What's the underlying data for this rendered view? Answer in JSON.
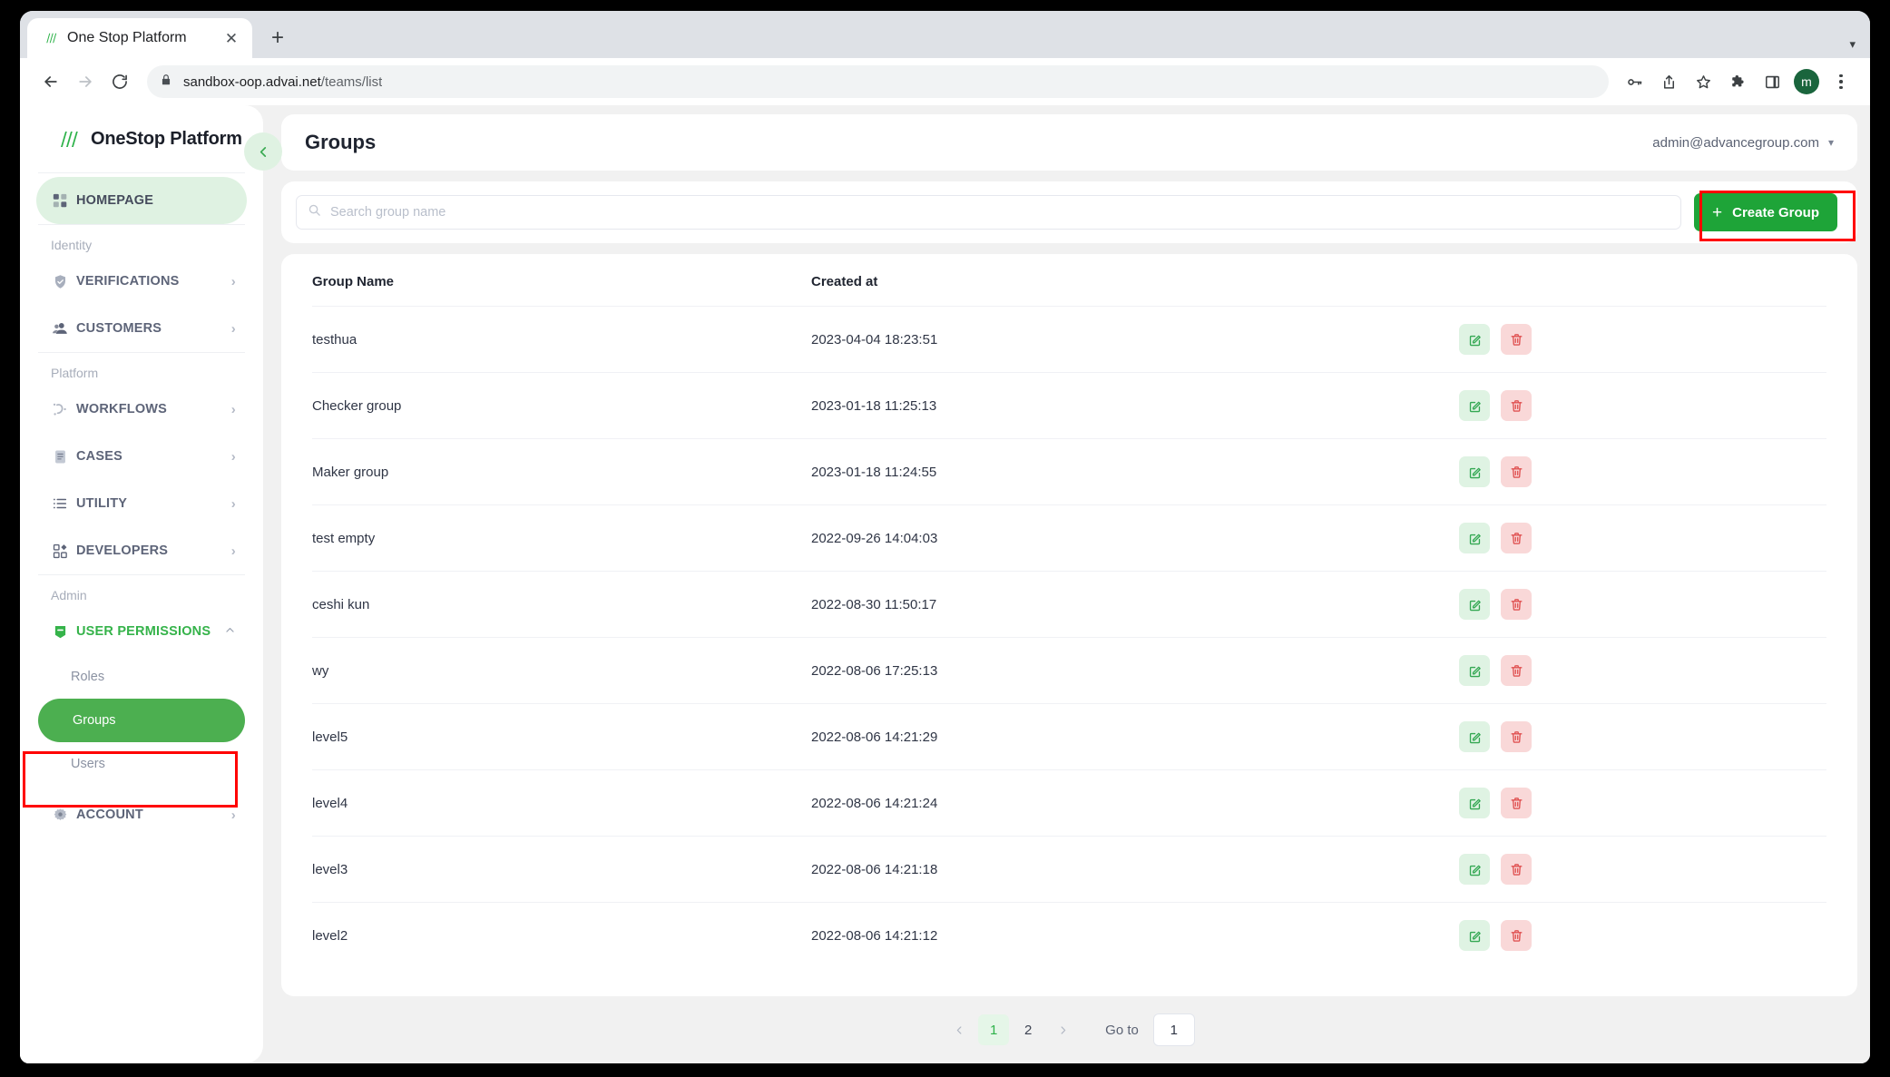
{
  "browser": {
    "tab": {
      "title": "One Stop Platform",
      "favicon": "onestop-logo-icon",
      "close_icon": "close-icon"
    },
    "new_tab_icon": "plus-icon",
    "window_menu_icon": "chevron-down-icon",
    "nav": {
      "back_icon": "back-arrow-icon",
      "forward_icon": "forward-arrow-icon",
      "reload_icon": "reload-icon"
    },
    "omnibox": {
      "lock_icon": "lock-icon",
      "url_domain": "sandbox-oop.advai.net",
      "url_path": "/teams/list",
      "full_url": "sandbox-oop.advai.net/teams/list"
    },
    "toolbar_icons": [
      "password-key-icon",
      "share-icon",
      "bookmark-star-icon",
      "extensions-puzzle-icon",
      "side-panel-icon"
    ],
    "profile_initial": "m",
    "menu_icon": "kebab-menu-icon"
  },
  "sidebar": {
    "brand": "OneStop Platform",
    "brand_logo_icon": "onestop-logo-icon",
    "collapse_icon": "chevron-left-icon",
    "home": {
      "label": "HOMEPAGE",
      "icon": "grid-squares-icon"
    },
    "sections": [
      {
        "title": "Identity",
        "items": [
          {
            "label": "VERIFICATIONS",
            "icon": "shield-check-icon",
            "arrow": "chevron-right-icon"
          },
          {
            "label": "CUSTOMERS",
            "icon": "people-icon",
            "arrow": "chevron-right-icon"
          }
        ]
      },
      {
        "title": "Platform",
        "items": [
          {
            "label": "WORKFLOWS",
            "icon": "workflow-nodes-icon",
            "arrow": "chevron-right-icon"
          },
          {
            "label": "CASES",
            "icon": "document-lines-icon",
            "arrow": "chevron-right-icon"
          },
          {
            "label": "UTILITY",
            "icon": "list-bullets-icon",
            "arrow": "chevron-right-icon"
          },
          {
            "label": "DEVELOPERS",
            "icon": "blocks-icon",
            "arrow": "chevron-right-icon"
          }
        ]
      },
      {
        "title": "Admin",
        "items": [
          {
            "label": "USER PERMISSIONS",
            "icon": "tag-minus-icon",
            "arrow": "chevron-up-icon",
            "expanded": true,
            "active": true
          },
          {
            "label": "ACCOUNT",
            "icon": "gear-icon",
            "arrow": "chevron-right-icon"
          }
        ]
      }
    ],
    "user_permissions_children": [
      {
        "label": "Roles",
        "selected": false
      },
      {
        "label": "Groups",
        "selected": true
      },
      {
        "label": "Users",
        "selected": false
      }
    ]
  },
  "header": {
    "title": "Groups",
    "account_email": "admin@advancegroup.com",
    "account_caret_icon": "chevron-down-icon"
  },
  "search": {
    "placeholder": "Search group name",
    "value": "",
    "icon": "search-icon"
  },
  "create_button": {
    "label": "Create Group",
    "icon": "plus-icon"
  },
  "table": {
    "columns": [
      "Group Name",
      "Created at",
      ""
    ],
    "rows": [
      {
        "name": "testhua",
        "created_at": "2023-04-04 18:23:51"
      },
      {
        "name": "Checker group",
        "created_at": "2023-01-18 11:25:13"
      },
      {
        "name": "Maker group",
        "created_at": "2023-01-18 11:24:55"
      },
      {
        "name": "test empty",
        "created_at": "2022-09-26 14:04:03"
      },
      {
        "name": "ceshi kun",
        "created_at": "2022-08-30 11:50:17"
      },
      {
        "name": "wy",
        "created_at": "2022-08-06 17:25:13"
      },
      {
        "name": "level5",
        "created_at": "2022-08-06 14:21:29"
      },
      {
        "name": "level4",
        "created_at": "2022-08-06 14:21:24"
      },
      {
        "name": "level3",
        "created_at": "2022-08-06 14:21:18"
      },
      {
        "name": "level2",
        "created_at": "2022-08-06 14:21:12"
      }
    ],
    "row_actions": {
      "edit_icon": "edit-pencil-icon",
      "delete_icon": "trash-bin-icon"
    }
  },
  "pagination": {
    "prev_icon": "chevron-left-icon",
    "next_icon": "chevron-right-icon",
    "pages": [
      "1",
      "2"
    ],
    "current_page": "1",
    "goto_label": "Go to",
    "goto_value": "1"
  },
  "colors": {
    "brand_green": "#1ea438",
    "selected_green": "#4caf50",
    "light_green": "#dff2e2",
    "annotation_red": "#ff0000",
    "text_dark": "#1f2430",
    "text_muted": "#8b92a2"
  }
}
